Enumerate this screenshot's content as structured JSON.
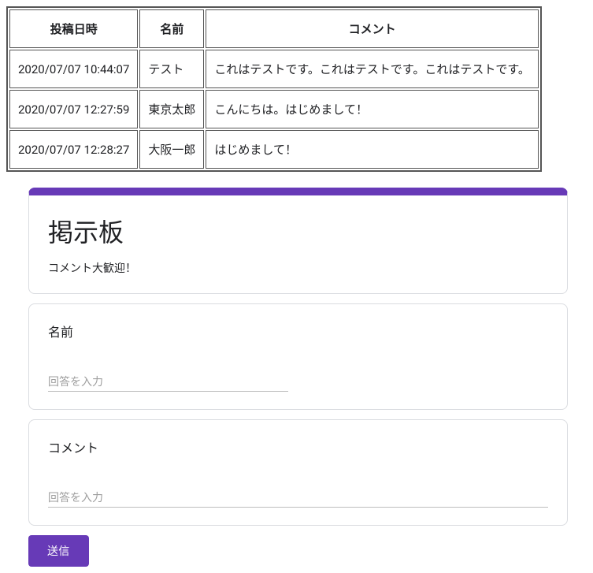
{
  "table": {
    "headers": [
      "投稿日時",
      "名前",
      "コメント"
    ],
    "rows": [
      {
        "datetime": "2020/07/07 10:44:07",
        "name": "テスト",
        "comment": "これはテストです。これはテストです。これはテストです。"
      },
      {
        "datetime": "2020/07/07 12:27:59",
        "name": "東京太郎",
        "comment": "こんにちは。はじめまして！"
      },
      {
        "datetime": "2020/07/07 12:28:27",
        "name": "大阪一郎",
        "comment": "はじめまして！"
      }
    ]
  },
  "form": {
    "title": "掲示板",
    "description": "コメント大歓迎！",
    "fields": {
      "name": {
        "label": "名前",
        "placeholder": "回答を入力"
      },
      "comment": {
        "label": "コメント",
        "placeholder": "回答を入力"
      }
    },
    "submit_label": "送信"
  },
  "colors": {
    "accent": "#673ab7"
  }
}
